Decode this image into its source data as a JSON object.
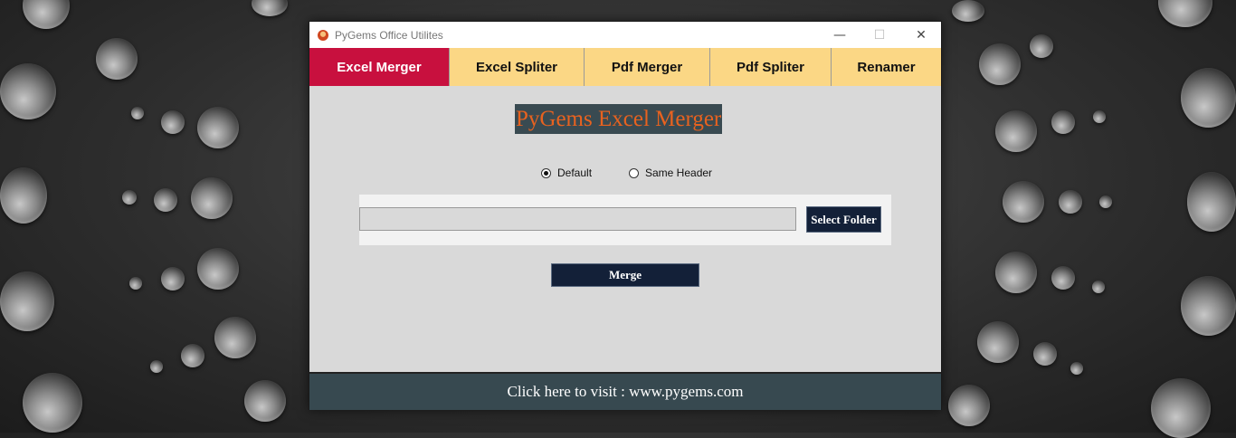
{
  "window": {
    "title": "PyGems Office Utilites",
    "controls": {
      "minimize": "—",
      "maximize": "☐",
      "close": "✕"
    }
  },
  "tabs": [
    {
      "label": "Excel Merger",
      "active": true
    },
    {
      "label": "Excel Spliter",
      "active": false
    },
    {
      "label": "Pdf Merger",
      "active": false
    },
    {
      "label": "Pdf Spliter",
      "active": false
    },
    {
      "label": "Renamer",
      "active": false
    }
  ],
  "main": {
    "heading": "PyGems Excel Merger",
    "options": [
      {
        "label": "Default",
        "selected": true
      },
      {
        "label": "Same Header",
        "selected": false
      }
    ],
    "folder_path": "",
    "select_folder_label": "Select Folder",
    "merge_label": "Merge"
  },
  "footer": {
    "link_text": "Click here to visit : www.pygems.com"
  },
  "colors": {
    "active_tab": "#c8103e",
    "inactive_tab": "#fbd785",
    "heading_bg": "#394a51",
    "heading_text": "#e8621f",
    "button_bg": "#132038",
    "footer_bg": "#374950"
  }
}
